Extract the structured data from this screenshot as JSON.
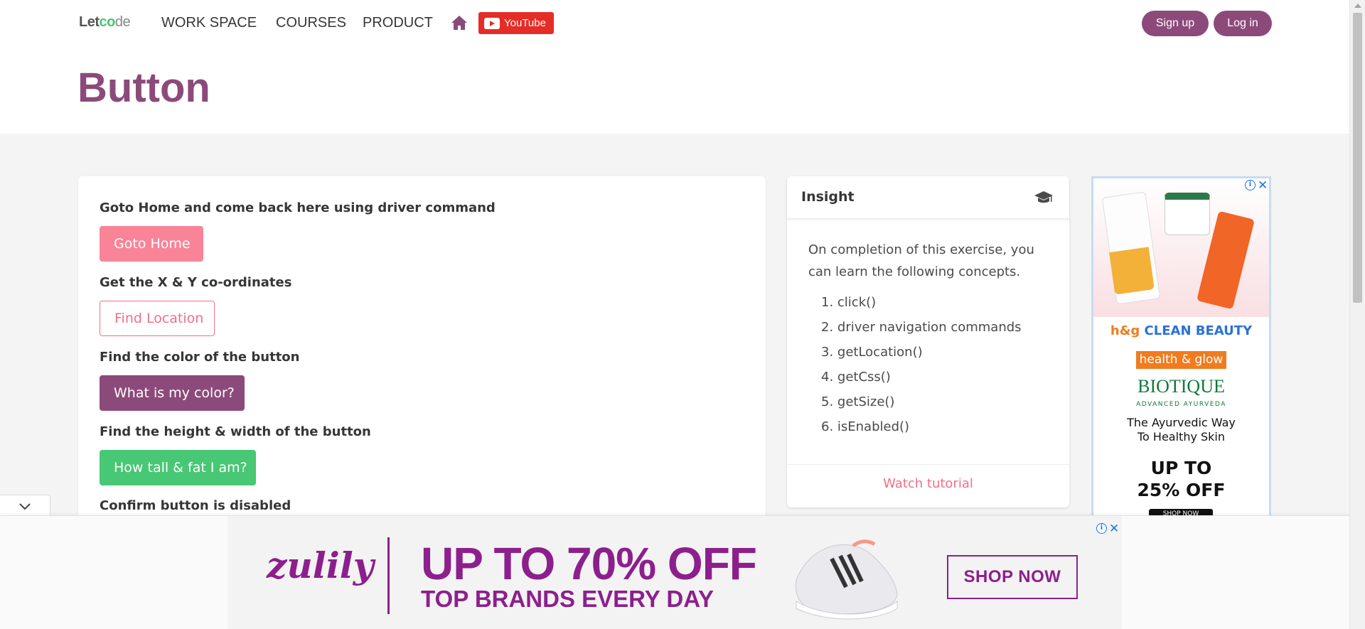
{
  "nav": {
    "logo_a": "Let",
    "logo_b": "co",
    "logo_c": "de",
    "links": [
      "WORK SPACE",
      "COURSES",
      "PRODUCT"
    ],
    "youtube_label": "YouTube",
    "signup_label": "Sign up",
    "login_label": "Log in"
  },
  "page": {
    "title": "Button"
  },
  "exercises": [
    {
      "question": "Goto Home and come back here using driver command",
      "button": "Goto Home"
    },
    {
      "question": "Get the X & Y co-ordinates",
      "button": "Find Location"
    },
    {
      "question": "Find the color of the button",
      "button": "What is my color?"
    },
    {
      "question": "Find the height & width of the button",
      "button": "How tall & fat I am?"
    },
    {
      "question": "Confirm button is disabled"
    }
  ],
  "insight": {
    "title": "Insight",
    "description": "On completion of this exercise, you can learn the following concepts.",
    "concepts": [
      "1. click()",
      "2. driver navigation commands",
      "3. getLocation()",
      "4. getCss()",
      "5. getSize()",
      "6. isEnabled()"
    ],
    "watch_label": "Watch tutorial"
  },
  "side_ad": {
    "brand_a": "h&g ",
    "brand_b": "CLEAN BEAUTY",
    "badge": "health & glow",
    "biotique": "BIOTIQUE",
    "biotique_sub": "ADVANCED AYURVEDA",
    "tagline_1": "The Ayurvedic Way",
    "tagline_2": "To Healthy Skin",
    "offer_1": "UP TO",
    "offer_2": "25% OFF",
    "shop": "SHOP NOW"
  },
  "bottom_ad": {
    "brand": "zulily",
    "headline": "UP TO 70% OFF",
    "subline": "TOP BRANDS EVERY DAY",
    "cta": "SHOP NOW"
  },
  "colors": {
    "brand_purple": "#8c4a7b",
    "pink": "#f98498",
    "green": "#48c774",
    "zulily_purple": "#8d1f8d"
  }
}
